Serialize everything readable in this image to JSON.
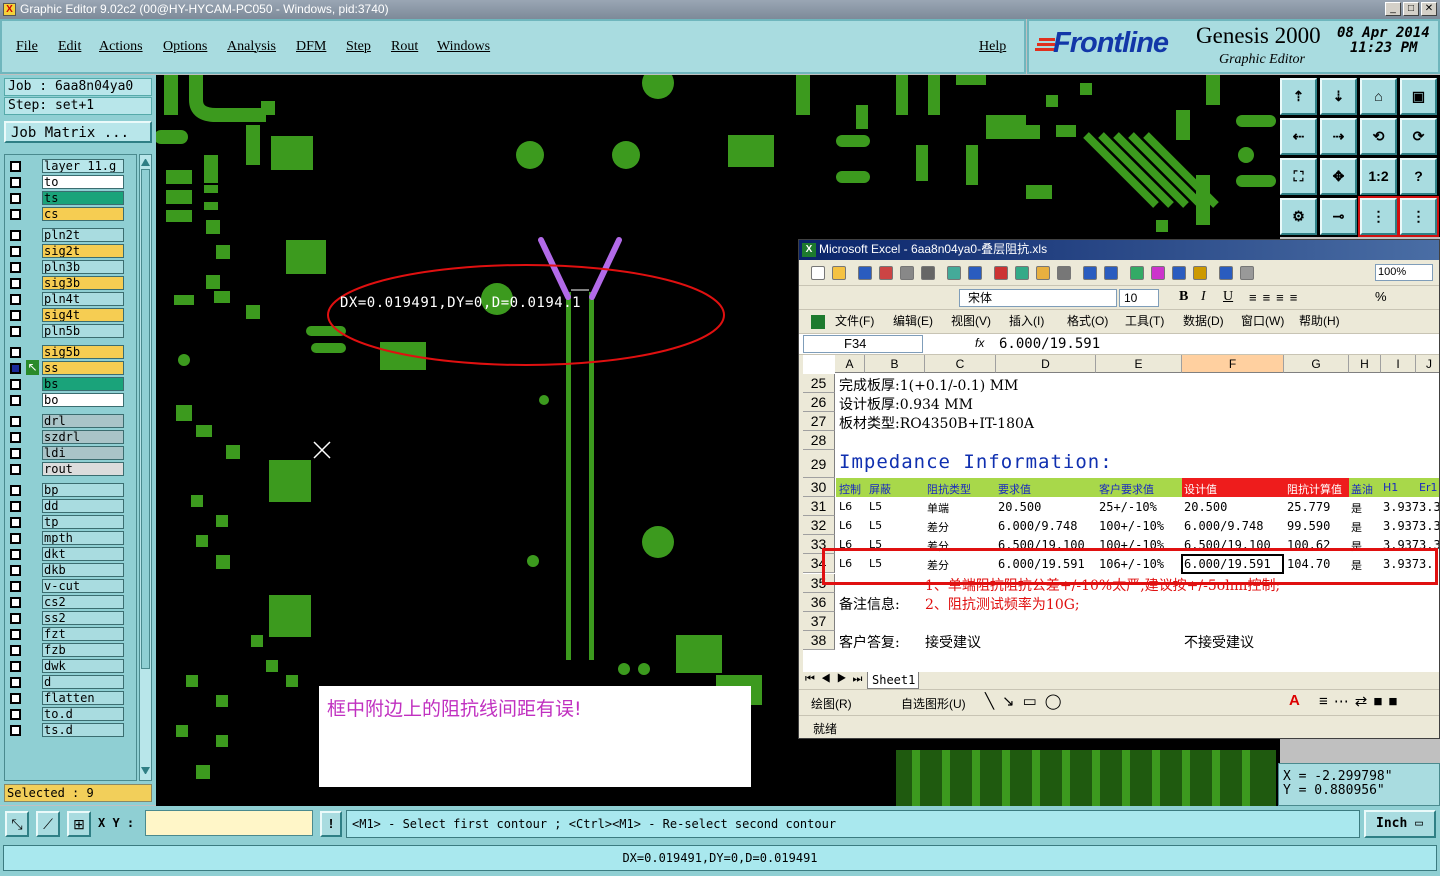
{
  "window": {
    "title": "Graphic Editor 9.02c2 (00@HY-HYCAM-PC050 - Windows, pid:3740)"
  },
  "menu": [
    "File",
    "Edit",
    "Actions",
    "Options",
    "Analysis",
    "DFM",
    "Step",
    "Rout",
    "Windows"
  ],
  "help": "Help",
  "brand": {
    "logo": "Frontline",
    "product": "Genesis 2000",
    "subtitle": "Graphic Editor",
    "date": "08 Apr 2014",
    "time": "11:23 PM"
  },
  "job": {
    "job_label": "Job : 6aa8n04ya0",
    "step_label": "Step: set+1",
    "matrix_button": "Job Matrix ..."
  },
  "layers": [
    {
      "name": "layer_11.g",
      "color": "#b8e6ea",
      "group": 0
    },
    {
      "name": "to",
      "color": "#ffffff",
      "group": 0
    },
    {
      "name": "ts",
      "color": "#1aa37a",
      "group": 0
    },
    {
      "name": "cs",
      "color": "#f6cd52",
      "group": 0
    },
    {
      "name": "pln2t",
      "color": "#a9dce0",
      "group": 1
    },
    {
      "name": "sig2t",
      "color": "#f6cd52",
      "group": 1
    },
    {
      "name": "pln3b",
      "color": "#a9dce0",
      "group": 1
    },
    {
      "name": "sig3b",
      "color": "#f6cd52",
      "group": 1
    },
    {
      "name": "pln4t",
      "color": "#a9dce0",
      "group": 1
    },
    {
      "name": "sig4t",
      "color": "#f6cd52",
      "group": 1
    },
    {
      "name": "pln5b",
      "color": "#a9dce0",
      "group": 1
    },
    {
      "name": "sig5b",
      "color": "#f6cd52",
      "group": 2
    },
    {
      "name": "ss",
      "color": "#f6cd52",
      "group": 2
    },
    {
      "name": "bs",
      "color": "#1aa37a",
      "group": 2
    },
    {
      "name": "bo",
      "color": "#ffffff",
      "group": 2
    },
    {
      "name": "drl",
      "color": "#a9c4c8",
      "group": 3
    },
    {
      "name": "szdrl",
      "color": "#a9c4c8",
      "group": 3
    },
    {
      "name": "ldi",
      "color": "#a9c4c8",
      "group": 3
    },
    {
      "name": "rout",
      "color": "#dcdcdc",
      "group": 3
    },
    {
      "name": "bp",
      "color": "#a9dce0",
      "group": 4
    },
    {
      "name": "dd",
      "color": "#a9dce0",
      "group": 4
    },
    {
      "name": "tp",
      "color": "#a9dce0",
      "group": 4
    },
    {
      "name": "mpth",
      "color": "#a9dce0",
      "group": 4
    },
    {
      "name": "dkt",
      "color": "#a9dce0",
      "group": 4
    },
    {
      "name": "dkb",
      "color": "#a9dce0",
      "group": 4
    },
    {
      "name": "v-cut",
      "color": "#a9dce0",
      "group": 4
    },
    {
      "name": "cs2",
      "color": "#a9dce0",
      "group": 4
    },
    {
      "name": "ss2",
      "color": "#a9dce0",
      "group": 4
    },
    {
      "name": "fzt",
      "color": "#a9dce0",
      "group": 4
    },
    {
      "name": "fzb",
      "color": "#a9dce0",
      "group": 4
    },
    {
      "name": "dwk",
      "color": "#a9dce0",
      "group": 4
    },
    {
      "name": "d",
      "color": "#a9dce0",
      "group": 4
    },
    {
      "name": "flatten",
      "color": "#a9dce0",
      "group": 4
    },
    {
      "name": "to.d",
      "color": "#a9dce0",
      "group": 4
    },
    {
      "name": "ts.d",
      "color": "#a9dce0",
      "group": 4
    }
  ],
  "selected": "Selected : 9",
  "canvas": {
    "measure_text": "DX=0.019491,DY=0,D=0.0194.1",
    "note": "框中附边上的阻抗线间距有误!"
  },
  "coords": {
    "x": "X = -2.299798\"",
    "y": "Y = 0.880956\""
  },
  "bottom": {
    "xy_label": "X Y :",
    "xy_value": "",
    "prompt": "<M1> - Select first contour ; <Ctrl><M1> - Re-select second contour",
    "units": "Inch"
  },
  "status": "DX=0.019491,DY=0,D=0.019491",
  "excel": {
    "title": "Microsoft Excel - 6aa8n04ya0-叠层阻抗.xls",
    "font_name": "宋体",
    "font_size": "10",
    "zoom": "100%",
    "menus": [
      "文件(F)",
      "编辑(E)",
      "视图(V)",
      "插入(I)",
      "格式(O)",
      "工具(T)",
      "数据(D)",
      "窗口(W)",
      "帮助(H)"
    ],
    "namebox": "F34",
    "formula": "6.000/19.591",
    "columns": [
      "A",
      "B",
      "C",
      "D",
      "E",
      "F",
      "G",
      "H",
      "I",
      "J"
    ],
    "rows": {
      "r25": {
        "num": "25",
        "text": "完成板厚:1(+0.1/-0.1) MM"
      },
      "r26": {
        "num": "26",
        "text": "设计板厚:0.934 MM"
      },
      "r27": {
        "num": "27",
        "text": "板材类型:RO4350B+IT-180A"
      },
      "r28": {
        "num": "28"
      },
      "r29": {
        "num": "29",
        "text": "Impedance Information:"
      },
      "r30": {
        "num": "30",
        "cells": [
          "控制",
          "屏蔽",
          "阻抗类型",
          "要求值",
          "客户要求值",
          "设计值",
          "阻抗计算值",
          "盖油",
          "H1",
          "Er1"
        ]
      },
      "r31": {
        "num": "31",
        "cells": [
          "L6",
          "L5",
          "单端",
          "20.500",
          "25+/-10%",
          "20.500",
          "25.779",
          "是",
          "3.937",
          "3.3"
        ]
      },
      "r32": {
        "num": "32",
        "cells": [
          "L6",
          "L5",
          "差分",
          "6.000/9.748",
          "100+/-10%",
          "6.000/9.748",
          "99.590",
          "是",
          "3.937",
          "3.3"
        ]
      },
      "r33": {
        "num": "33",
        "cells": [
          "L6",
          "L5",
          "差分",
          "6.500/19.100",
          "100+/-10%",
          "6.500/19.100",
          "100.62",
          "是",
          "3.937",
          "3.3"
        ]
      },
      "r34": {
        "num": "34",
        "cells": [
          "L6",
          "L5",
          "差分",
          "6.000/19.591",
          "106+/-10%",
          "6.000/19.591",
          "104.70",
          "是",
          "3.937",
          "3."
        ]
      },
      "r35": {
        "num": "35"
      },
      "r36": {
        "num": "36",
        "label": "备注信息:",
        "note1": "1、单端阻抗阻抗公差+/-10%太严,建议按+/-5ohm控制;",
        "note2": "2、阻抗测试频率为10G;"
      },
      "r37": {
        "num": "37"
      },
      "r38": {
        "num": "38",
        "label": "客户答复:",
        "accept": "接受建议",
        "reject": "不接受建议"
      }
    },
    "sheet_tab": "Sheet1",
    "draw_label": "绘图(R)",
    "autoshape_label": "自选图形(U)",
    "status": "就绪"
  }
}
